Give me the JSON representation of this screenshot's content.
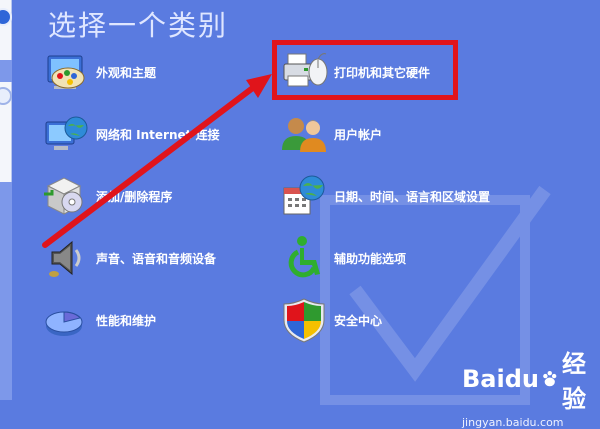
{
  "window": {
    "heading": "选择一个类别"
  },
  "categories": [
    {
      "label": "外观和主题",
      "icon": "appearance-theme-icon"
    },
    {
      "label": "打印机和其它硬件",
      "icon": "printer-hardware-icon"
    },
    {
      "label": "网络和 Internet 连接",
      "icon": "network-internet-icon"
    },
    {
      "label": "用户帐户",
      "icon": "user-accounts-icon"
    },
    {
      "label": "添加/删除程序",
      "icon": "add-remove-programs-icon"
    },
    {
      "label": "日期、时间、语言和区域设置",
      "icon": "date-time-region-icon"
    },
    {
      "label": "声音、语音和音频设备",
      "icon": "sound-audio-icon"
    },
    {
      "label": "辅助功能选项",
      "icon": "accessibility-icon"
    },
    {
      "label": "性能和维护",
      "icon": "performance-maintenance-icon"
    },
    {
      "label": "安全中心",
      "icon": "security-center-icon"
    }
  ],
  "annotation": {
    "highlight_color": "#e0141b",
    "target": "打印机和其它硬件"
  },
  "watermark": {
    "brand": "Baidu",
    "brand_cn": "经验",
    "url": "jingyan.baidu.com"
  },
  "colors": {
    "background": "#5a7be0",
    "label": "#ffffff",
    "heading": "#dfe6ff"
  }
}
